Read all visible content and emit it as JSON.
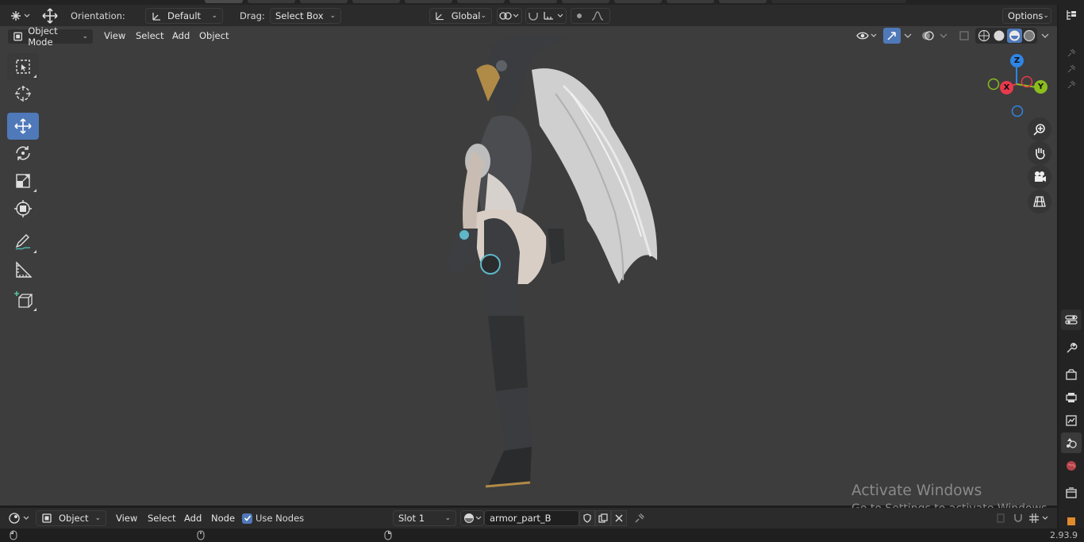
{
  "tool_header": {
    "orientation_label": "Orientation:",
    "orientation_value": "Default",
    "drag_label": "Drag:",
    "drag_value": "Select Box",
    "transform_orientation": "Global",
    "options_label": "Options"
  },
  "viewport_header": {
    "mode": "Object Mode",
    "menus": [
      "View",
      "Select",
      "Add",
      "Object"
    ]
  },
  "gizmo": {
    "z_label": "Z",
    "x_label": "X",
    "y_label": "Y",
    "x_color": "#e8394d",
    "y_color": "#8bbd1e",
    "z_color": "#2f85e6"
  },
  "shader_header": {
    "type": "Object",
    "menus": [
      "View",
      "Select",
      "Add",
      "Node"
    ],
    "use_nodes_label": "Use Nodes",
    "slot_value": "Slot 1",
    "material_name": "armor_part_B"
  },
  "watermark": {
    "title": "Activate Windows",
    "subtitle": "Go to Settings to activate Windows."
  },
  "status_bar": {
    "version": "2.93.9"
  },
  "colors": {
    "accent": "#4f79b9",
    "viewport_bg": "#3d3d3d"
  }
}
